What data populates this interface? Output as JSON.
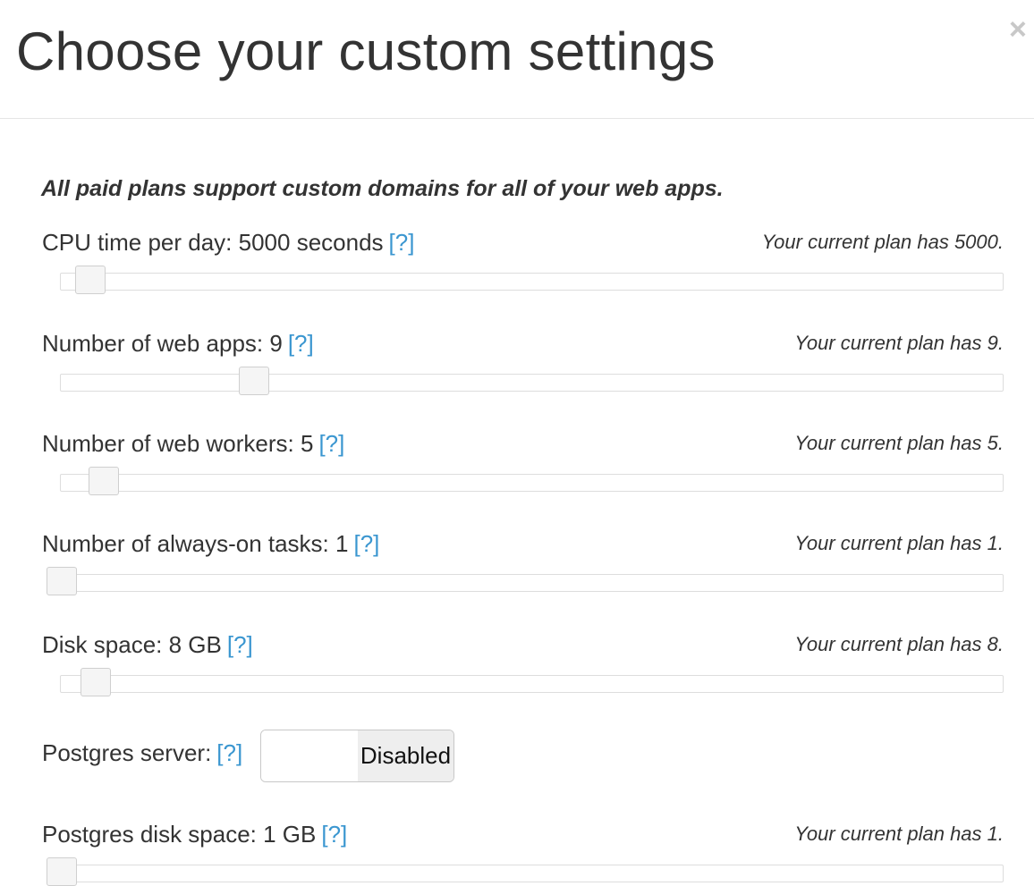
{
  "dialog": {
    "title": "Choose your custom settings",
    "close_glyph": "×",
    "intro": "All paid plans support custom domains for all of your web apps."
  },
  "help_text": "[?]",
  "settings": [
    {
      "label": "CPU time per day: 5000 seconds",
      "current": "Your current plan has 5000.",
      "level": 0.03
    },
    {
      "label": "Number of web apps: 9",
      "current": "Your current plan has 9.",
      "level": 0.205
    },
    {
      "label": "Number of web workers: 5",
      "current": "Your current plan has 5.",
      "level": 0.045
    },
    {
      "label": "Number of always-on tasks: 1",
      "current": "Your current plan has 1.",
      "level": 0.0
    },
    {
      "label": "Disk space: 8 GB",
      "current": "Your current plan has 8.",
      "level": 0.036
    },
    {
      "label": "Postgres disk space: 1 GB",
      "current": "Your current plan has 1.",
      "level": 0.0
    }
  ],
  "postgres": {
    "label": "Postgres server:",
    "toggle_state": "Disabled"
  },
  "colors": {
    "link": "#3a96d0",
    "text": "#333333",
    "close": "#c8c8c8"
  }
}
